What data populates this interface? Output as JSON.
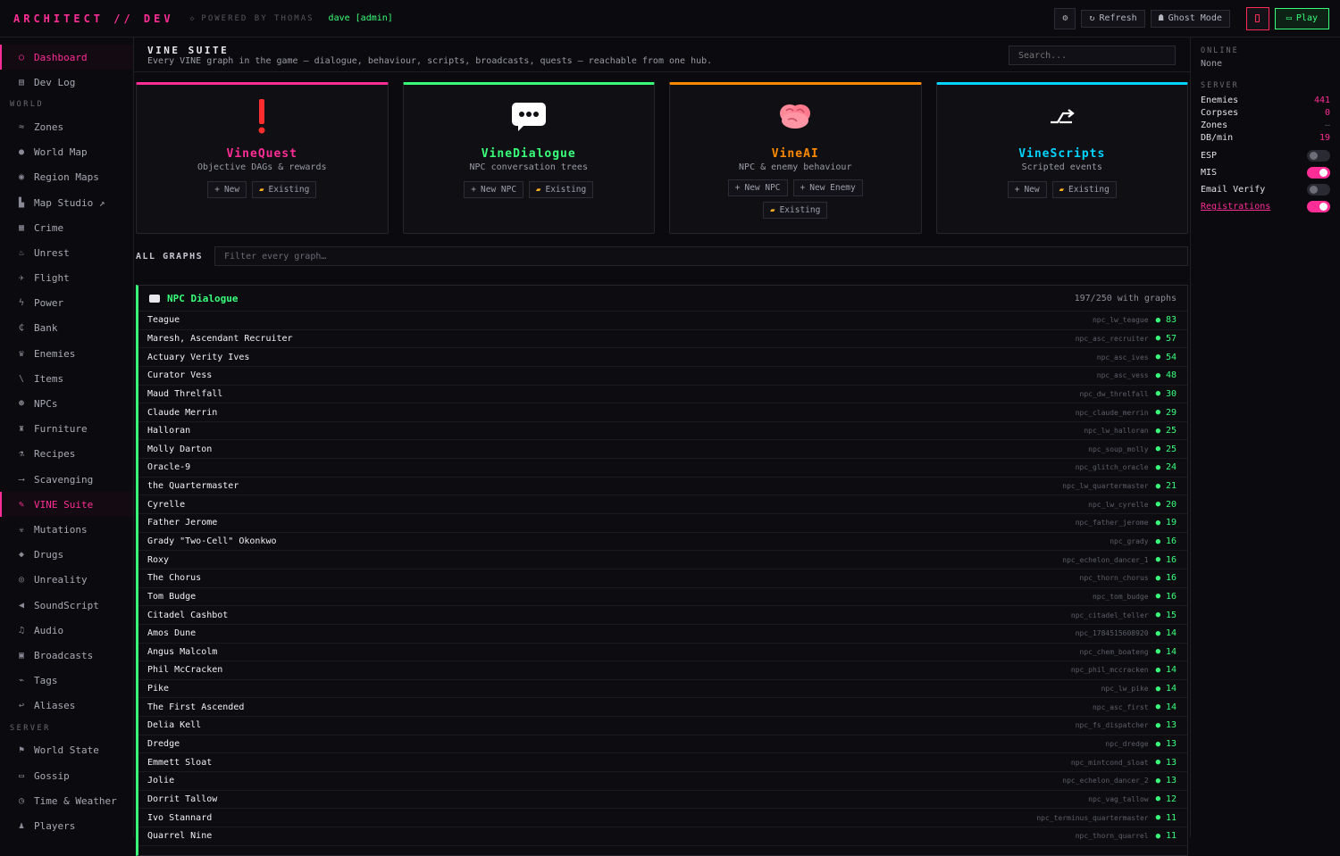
{
  "topbar": {
    "brand": "ARCHITECT // DEV",
    "powered": "POWERED BY THOMAS",
    "user": "dave [admin]",
    "refresh": "Refresh",
    "ghost": "Ghost Mode",
    "play": "Play"
  },
  "sidebar": {
    "items_top": [
      {
        "label": "Dashboard",
        "icon": "circle-icon",
        "glyph": "○",
        "active": true
      },
      {
        "label": "Dev Log",
        "icon": "notebook-icon",
        "glyph": "▤"
      }
    ],
    "world_title": "WORLD",
    "world_items": [
      {
        "label": "Zones",
        "icon": "zones-icon",
        "glyph": "≈"
      },
      {
        "label": "World Map",
        "icon": "globe-icon",
        "glyph": "●"
      },
      {
        "label": "Region Maps",
        "icon": "compass-icon",
        "glyph": "◉"
      },
      {
        "label": "Map Studio ↗",
        "icon": "map-studio-icon",
        "glyph": "▙"
      },
      {
        "label": "Crime",
        "icon": "crime-icon",
        "glyph": "▦"
      },
      {
        "label": "Unrest",
        "icon": "fire-icon",
        "glyph": "♨"
      },
      {
        "label": "Flight",
        "icon": "plane-icon",
        "glyph": "✈"
      },
      {
        "label": "Power",
        "icon": "lightning-icon",
        "glyph": "ϟ"
      },
      {
        "label": "Bank",
        "icon": "currency-icon",
        "glyph": "₵"
      },
      {
        "label": "Enemies",
        "icon": "enemy-icon",
        "glyph": "♛"
      },
      {
        "label": "Items",
        "icon": "items-icon",
        "glyph": "\\"
      },
      {
        "label": "NPCs",
        "icon": "npc-face-icon",
        "glyph": "☻"
      },
      {
        "label": "Furniture",
        "icon": "furniture-icon",
        "glyph": "♜"
      },
      {
        "label": "Recipes",
        "icon": "recipes-icon",
        "glyph": "⚗"
      },
      {
        "label": "Scavenging",
        "icon": "scavenging-icon",
        "glyph": "⟶"
      },
      {
        "label": "VINE Suite",
        "icon": "vine-icon",
        "glyph": "✎",
        "active": true
      },
      {
        "label": "Mutations",
        "icon": "mutations-icon",
        "glyph": "☣"
      },
      {
        "label": "Drugs",
        "icon": "pill-icon",
        "glyph": "◆"
      },
      {
        "label": "Unreality",
        "icon": "unreality-icon",
        "glyph": "◎"
      },
      {
        "label": "SoundScript",
        "icon": "speaker-icon",
        "glyph": "◀"
      },
      {
        "label": "Audio",
        "icon": "music-note-icon",
        "glyph": "♫"
      },
      {
        "label": "Broadcasts",
        "icon": "tv-icon",
        "glyph": "▣"
      },
      {
        "label": "Tags",
        "icon": "tag-icon",
        "glyph": "⌁"
      },
      {
        "label": "Aliases",
        "icon": "alias-icon",
        "glyph": "↩"
      }
    ],
    "server_title": "SERVER",
    "server_items": [
      {
        "label": "World State",
        "icon": "flag-icon",
        "glyph": "⚑"
      },
      {
        "label": "Gossip",
        "icon": "chat-icon",
        "glyph": "▭"
      },
      {
        "label": "Time & Weather",
        "icon": "clock-icon",
        "glyph": "◷"
      },
      {
        "label": "Players",
        "icon": "players-icon",
        "glyph": "♟"
      }
    ]
  },
  "main": {
    "title": "VINE SUITE",
    "subtitle": "Every VINE graph in the game — dialogue, behaviour, scripts, broadcasts, quests — reachable from one hub.",
    "search_placeholder": "Search...",
    "cards": [
      {
        "title": "VineQuest",
        "subtitle": "Objective DAGs & rewards",
        "color": "#ff2d95",
        "btns": [
          "New",
          "Existing"
        ]
      },
      {
        "title": "VineDialogue",
        "subtitle": "NPC conversation trees",
        "color": "#39ff7a",
        "btns": [
          "New NPC",
          "Existing"
        ]
      },
      {
        "title": "VineAI",
        "subtitle": "NPC & enemy behaviour",
        "color": "#ff8a00",
        "btns": [
          "New NPC",
          "New Enemy",
          "Existing"
        ]
      },
      {
        "title": "VineScripts",
        "subtitle": "Scripted events",
        "color": "#00d4ff",
        "btns": [
          "New",
          "Existing"
        ]
      }
    ],
    "all_graphs_label": "ALL GRAPHS",
    "filter_placeholder": "Filter every graph…",
    "panel": {
      "title": "NPC Dialogue",
      "count": "197/250 with graphs",
      "rows": [
        {
          "name": "Teague",
          "id": "npc_lw_teague",
          "count": "83"
        },
        {
          "name": "Maresh, Ascendant Recruiter",
          "id": "npc_asc_recruiter",
          "count": "57"
        },
        {
          "name": "Actuary Verity Ives",
          "id": "npc_asc_ives",
          "count": "54"
        },
        {
          "name": "Curator Vess",
          "id": "npc_asc_vess",
          "count": "48"
        },
        {
          "name": "Maud Threlfall",
          "id": "npc_dw_threlfall",
          "count": "30"
        },
        {
          "name": "Claude Merrin",
          "id": "npc_claude_merrin",
          "count": "29"
        },
        {
          "name": "Halloran",
          "id": "npc_lw_halloran",
          "count": "25"
        },
        {
          "name": "Molly Darton",
          "id": "npc_soup_molly",
          "count": "25"
        },
        {
          "name": "Oracle-9",
          "id": "npc_glitch_oracle",
          "count": "24"
        },
        {
          "name": "the Quartermaster",
          "id": "npc_lw_quartermaster",
          "count": "21"
        },
        {
          "name": "Cyrelle",
          "id": "npc_lw_cyrelle",
          "count": "20"
        },
        {
          "name": "Father Jerome",
          "id": "npc_father_jerome",
          "count": "19"
        },
        {
          "name": "Grady \"Two-Cell\" Okonkwo",
          "id": "npc_grady",
          "count": "16"
        },
        {
          "name": "Roxy",
          "id": "npc_echelon_dancer_1",
          "count": "16"
        },
        {
          "name": "The Chorus",
          "id": "npc_thorn_chorus",
          "count": "16"
        },
        {
          "name": "Tom Budge",
          "id": "npc_tom_budge",
          "count": "16"
        },
        {
          "name": "Citadel Cashbot",
          "id": "npc_citadel_teller",
          "count": "15"
        },
        {
          "name": "Amos Dune",
          "id": "npc_1784515608920",
          "count": "14"
        },
        {
          "name": "Angus Malcolm",
          "id": "npc_chem_boateng",
          "count": "14"
        },
        {
          "name": "Phil McCracken",
          "id": "npc_phil_mccracken",
          "count": "14"
        },
        {
          "name": "Pike",
          "id": "npc_lw_pike",
          "count": "14"
        },
        {
          "name": "The First Ascended",
          "id": "npc_asc_first",
          "count": "14"
        },
        {
          "name": "Delia Kell",
          "id": "npc_fs_dispatcher",
          "count": "13"
        },
        {
          "name": "Dredge",
          "id": "npc_dredge",
          "count": "13"
        },
        {
          "name": "Emmett Sloat",
          "id": "npc_mintcond_sloat",
          "count": "13"
        },
        {
          "name": "Jolie",
          "id": "npc_echelon_dancer_2",
          "count": "13"
        },
        {
          "name": "Dorrit Tallow",
          "id": "npc_vag_tallow",
          "count": "12"
        },
        {
          "name": "Ivo Stannard",
          "id": "npc_terminus_quartermaster",
          "count": "11"
        },
        {
          "name": "Quarrel Nine",
          "id": "npc_thorn_quarrel",
          "count": "11"
        }
      ]
    }
  },
  "right": {
    "online_title": "ONLINE",
    "online_value": "None",
    "server_title": "SERVER",
    "stats": [
      {
        "label": "Enemies",
        "value": "441"
      },
      {
        "label": "Corpses",
        "value": "0"
      },
      {
        "label": "Zones",
        "value": "—"
      },
      {
        "label": "DB/min",
        "value": "19"
      }
    ],
    "toggles": [
      {
        "label": "ESP",
        "on": false
      },
      {
        "label": "MIS",
        "on": true
      },
      {
        "label": "Email Verify",
        "on": false
      },
      {
        "label": "Registrations",
        "on": true
      }
    ]
  }
}
